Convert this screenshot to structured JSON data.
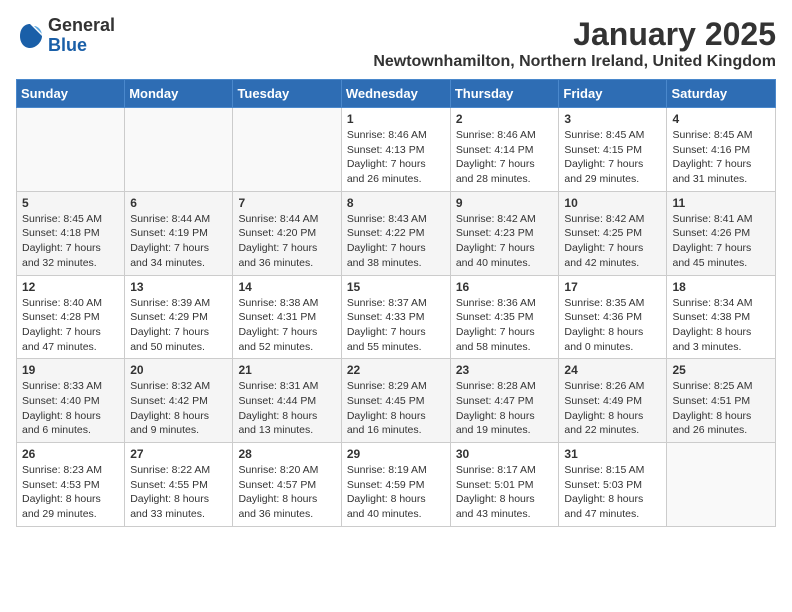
{
  "header": {
    "logo_general": "General",
    "logo_blue": "Blue",
    "month_title": "January 2025",
    "location": "Newtownhamilton, Northern Ireland, United Kingdom"
  },
  "calendar": {
    "days_of_week": [
      "Sunday",
      "Monday",
      "Tuesday",
      "Wednesday",
      "Thursday",
      "Friday",
      "Saturday"
    ],
    "weeks": [
      [
        {
          "day": "",
          "info": ""
        },
        {
          "day": "",
          "info": ""
        },
        {
          "day": "",
          "info": ""
        },
        {
          "day": "1",
          "info": "Sunrise: 8:46 AM\nSunset: 4:13 PM\nDaylight: 7 hours and 26 minutes."
        },
        {
          "day": "2",
          "info": "Sunrise: 8:46 AM\nSunset: 4:14 PM\nDaylight: 7 hours and 28 minutes."
        },
        {
          "day": "3",
          "info": "Sunrise: 8:45 AM\nSunset: 4:15 PM\nDaylight: 7 hours and 29 minutes."
        },
        {
          "day": "4",
          "info": "Sunrise: 8:45 AM\nSunset: 4:16 PM\nDaylight: 7 hours and 31 minutes."
        }
      ],
      [
        {
          "day": "5",
          "info": "Sunrise: 8:45 AM\nSunset: 4:18 PM\nDaylight: 7 hours and 32 minutes."
        },
        {
          "day": "6",
          "info": "Sunrise: 8:44 AM\nSunset: 4:19 PM\nDaylight: 7 hours and 34 minutes."
        },
        {
          "day": "7",
          "info": "Sunrise: 8:44 AM\nSunset: 4:20 PM\nDaylight: 7 hours and 36 minutes."
        },
        {
          "day": "8",
          "info": "Sunrise: 8:43 AM\nSunset: 4:22 PM\nDaylight: 7 hours and 38 minutes."
        },
        {
          "day": "9",
          "info": "Sunrise: 8:42 AM\nSunset: 4:23 PM\nDaylight: 7 hours and 40 minutes."
        },
        {
          "day": "10",
          "info": "Sunrise: 8:42 AM\nSunset: 4:25 PM\nDaylight: 7 hours and 42 minutes."
        },
        {
          "day": "11",
          "info": "Sunrise: 8:41 AM\nSunset: 4:26 PM\nDaylight: 7 hours and 45 minutes."
        }
      ],
      [
        {
          "day": "12",
          "info": "Sunrise: 8:40 AM\nSunset: 4:28 PM\nDaylight: 7 hours and 47 minutes."
        },
        {
          "day": "13",
          "info": "Sunrise: 8:39 AM\nSunset: 4:29 PM\nDaylight: 7 hours and 50 minutes."
        },
        {
          "day": "14",
          "info": "Sunrise: 8:38 AM\nSunset: 4:31 PM\nDaylight: 7 hours and 52 minutes."
        },
        {
          "day": "15",
          "info": "Sunrise: 8:37 AM\nSunset: 4:33 PM\nDaylight: 7 hours and 55 minutes."
        },
        {
          "day": "16",
          "info": "Sunrise: 8:36 AM\nSunset: 4:35 PM\nDaylight: 7 hours and 58 minutes."
        },
        {
          "day": "17",
          "info": "Sunrise: 8:35 AM\nSunset: 4:36 PM\nDaylight: 8 hours and 0 minutes."
        },
        {
          "day": "18",
          "info": "Sunrise: 8:34 AM\nSunset: 4:38 PM\nDaylight: 8 hours and 3 minutes."
        }
      ],
      [
        {
          "day": "19",
          "info": "Sunrise: 8:33 AM\nSunset: 4:40 PM\nDaylight: 8 hours and 6 minutes."
        },
        {
          "day": "20",
          "info": "Sunrise: 8:32 AM\nSunset: 4:42 PM\nDaylight: 8 hours and 9 minutes."
        },
        {
          "day": "21",
          "info": "Sunrise: 8:31 AM\nSunset: 4:44 PM\nDaylight: 8 hours and 13 minutes."
        },
        {
          "day": "22",
          "info": "Sunrise: 8:29 AM\nSunset: 4:45 PM\nDaylight: 8 hours and 16 minutes."
        },
        {
          "day": "23",
          "info": "Sunrise: 8:28 AM\nSunset: 4:47 PM\nDaylight: 8 hours and 19 minutes."
        },
        {
          "day": "24",
          "info": "Sunrise: 8:26 AM\nSunset: 4:49 PM\nDaylight: 8 hours and 22 minutes."
        },
        {
          "day": "25",
          "info": "Sunrise: 8:25 AM\nSunset: 4:51 PM\nDaylight: 8 hours and 26 minutes."
        }
      ],
      [
        {
          "day": "26",
          "info": "Sunrise: 8:23 AM\nSunset: 4:53 PM\nDaylight: 8 hours and 29 minutes."
        },
        {
          "day": "27",
          "info": "Sunrise: 8:22 AM\nSunset: 4:55 PM\nDaylight: 8 hours and 33 minutes."
        },
        {
          "day": "28",
          "info": "Sunrise: 8:20 AM\nSunset: 4:57 PM\nDaylight: 8 hours and 36 minutes."
        },
        {
          "day": "29",
          "info": "Sunrise: 8:19 AM\nSunset: 4:59 PM\nDaylight: 8 hours and 40 minutes."
        },
        {
          "day": "30",
          "info": "Sunrise: 8:17 AM\nSunset: 5:01 PM\nDaylight: 8 hours and 43 minutes."
        },
        {
          "day": "31",
          "info": "Sunrise: 8:15 AM\nSunset: 5:03 PM\nDaylight: 8 hours and 47 minutes."
        },
        {
          "day": "",
          "info": ""
        }
      ]
    ]
  }
}
